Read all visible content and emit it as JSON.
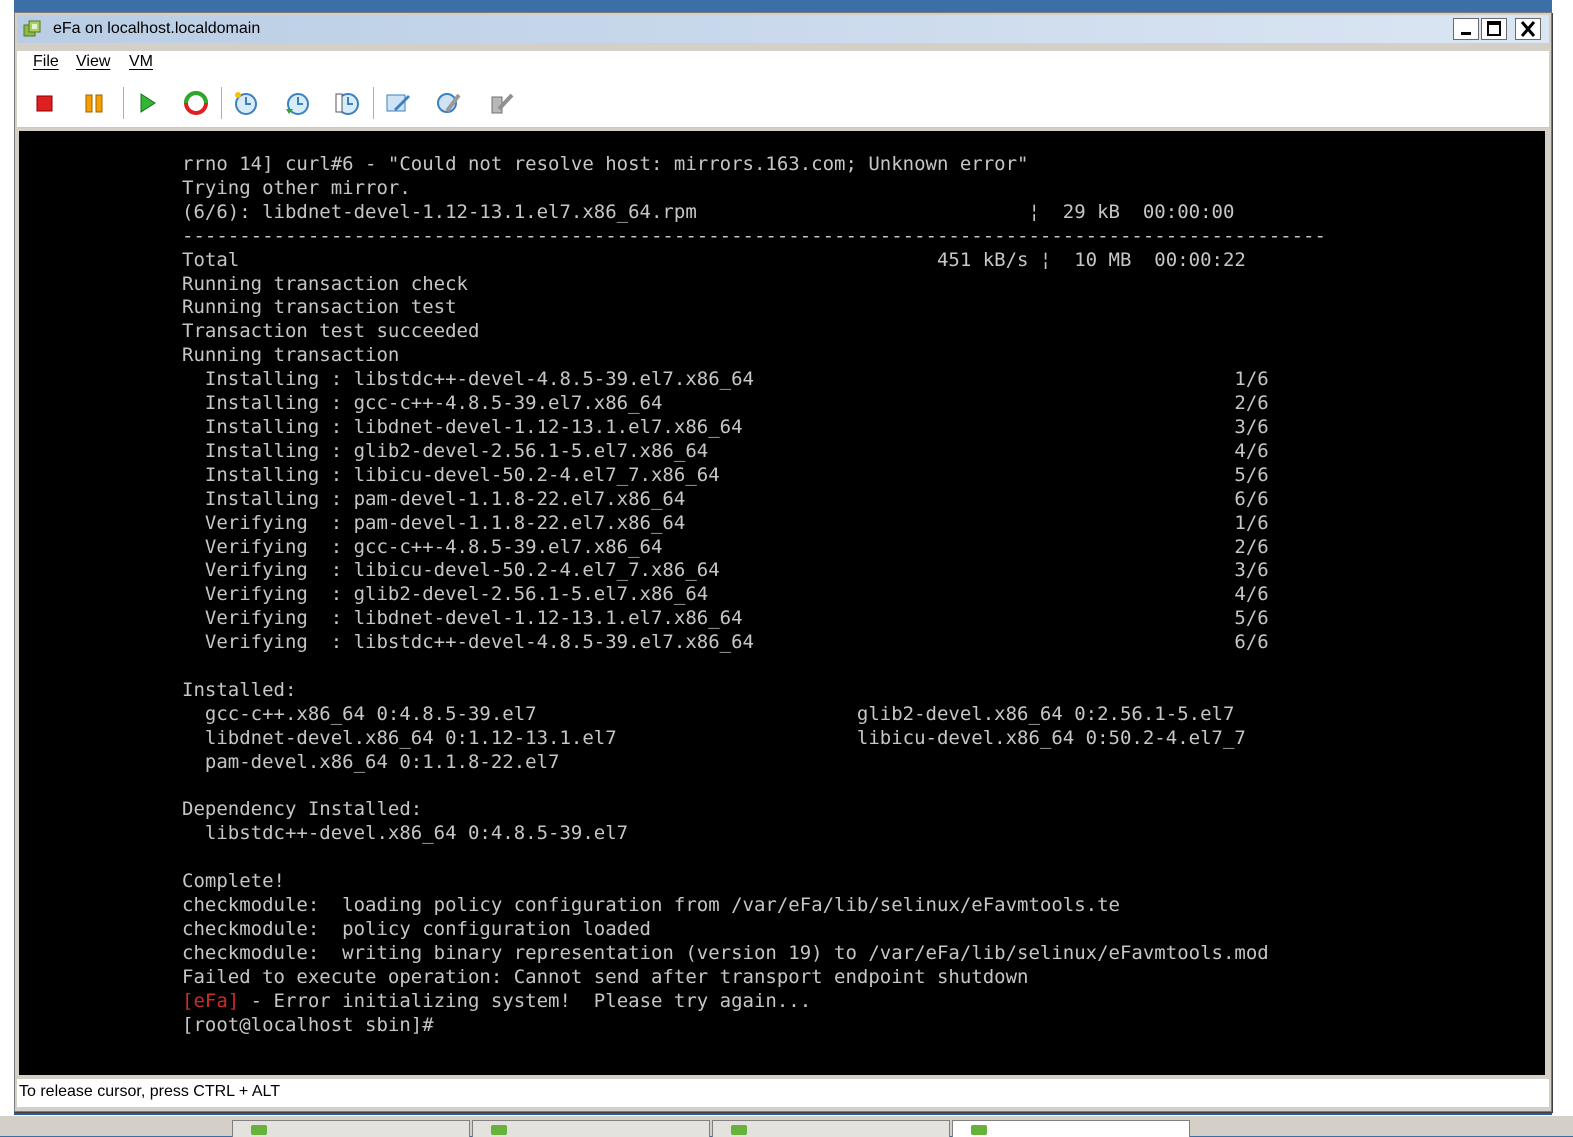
{
  "window": {
    "title": "eFa on localhost.localdomain",
    "minimize_icon": "minimize-icon",
    "maximize_icon": "maximize-icon",
    "close_icon": "close-icon"
  },
  "menu": {
    "file": "File",
    "view": "View",
    "vm": "VM"
  },
  "toolbar": {
    "items": [
      "stop-icon",
      "pause-icon",
      "play-icon",
      "reset-icon",
      "snapshot-icon",
      "revert-icon",
      "snapshot-manager-icon",
      "settings-icon",
      "tools-icon",
      "install-tools-icon"
    ]
  },
  "console": {
    "lines": [
      "rrno 14] curl#6 - \"Could not resolve host: mirrors.163.com; Unknown error\"",
      "Trying other mirror.",
      "(6/6): libdnet-devel-1.12-13.1.el7.x86_64.rpm                             ¦  29 kB  00:00:00",
      "----------------------------------------------------------------------------------------------------",
      "Total                                                             451 kB/s ¦  10 MB  00:00:22",
      "Running transaction check",
      "Running transaction test",
      "Transaction test succeeded",
      "Running transaction",
      "  Installing : libstdc++-devel-4.8.5-39.el7.x86_64                                          1/6",
      "  Installing : gcc-c++-4.8.5-39.el7.x86_64                                                  2/6",
      "  Installing : libdnet-devel-1.12-13.1.el7.x86_64                                           3/6",
      "  Installing : glib2-devel-2.56.1-5.el7.x86_64                                              4/6",
      "  Installing : libicu-devel-50.2-4.el7_7.x86_64                                             5/6",
      "  Installing : pam-devel-1.1.8-22.el7.x86_64                                                6/6",
      "  Verifying  : pam-devel-1.1.8-22.el7.x86_64                                                1/6",
      "  Verifying  : gcc-c++-4.8.5-39.el7.x86_64                                                  2/6",
      "  Verifying  : libicu-devel-50.2-4.el7_7.x86_64                                             3/6",
      "  Verifying  : glib2-devel-2.56.1-5.el7.x86_64                                              4/6",
      "  Verifying  : libdnet-devel-1.12-13.1.el7.x86_64                                           5/6",
      "  Verifying  : libstdc++-devel-4.8.5-39.el7.x86_64                                          6/6",
      "",
      "Installed:",
      "  gcc-c++.x86_64 0:4.8.5-39.el7                            glib2-devel.x86_64 0:2.56.1-5.el7",
      "  libdnet-devel.x86_64 0:1.12-13.1.el7                     libicu-devel.x86_64 0:50.2-4.el7_7",
      "  pam-devel.x86_64 0:1.1.8-22.el7",
      "",
      "Dependency Installed:",
      "  libstdc++-devel.x86_64 0:4.8.5-39.el7",
      "",
      "Complete!",
      "checkmodule:  loading policy configuration from /var/eFa/lib/selinux/eFavmtools.te",
      "checkmodule:  policy configuration loaded",
      "checkmodule:  writing binary representation (version 19) to /var/eFa/lib/selinux/eFavmtools.mod",
      "Failed to execute operation: Cannot send after transport endpoint shutdown"
    ],
    "error_tag": "[eFa]",
    "error_message": " - Error initializing system!  Please try again...",
    "prompt": "[root@localhost sbin]#",
    "colors": {
      "background": "#000000",
      "text": "#c6c6c6",
      "error_tag": "#cc2b2b"
    }
  },
  "status": {
    "text": "To release cursor, press CTRL + ALT"
  }
}
